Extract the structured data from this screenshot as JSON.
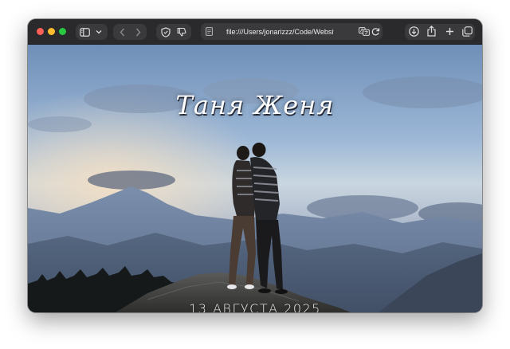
{
  "browser": {
    "address": "file:///Users/jonarizzz/Code/Website/jonarizzz",
    "icons": {
      "sidebar": "sidebar-icon",
      "chevron": "chevron-down-icon",
      "back": "back-icon",
      "forward": "forward-icon",
      "shield": "shield-icon",
      "thumbs_down": "thumbs-down-icon",
      "page": "page-icon",
      "translate": "translate-icon",
      "reload": "reload-icon",
      "downloads": "download-icon",
      "share": "share-icon",
      "new_tab": "plus-icon",
      "tabs": "tabs-overview-icon"
    }
  },
  "page": {
    "title": "Таня Женя",
    "date": "13 АВГУСТА 2025"
  },
  "colors": {
    "sky_top": "#6f8fb8",
    "sky_glow": "#e9d8c0",
    "mountains": "#4e6078",
    "text": "#ffffff"
  }
}
